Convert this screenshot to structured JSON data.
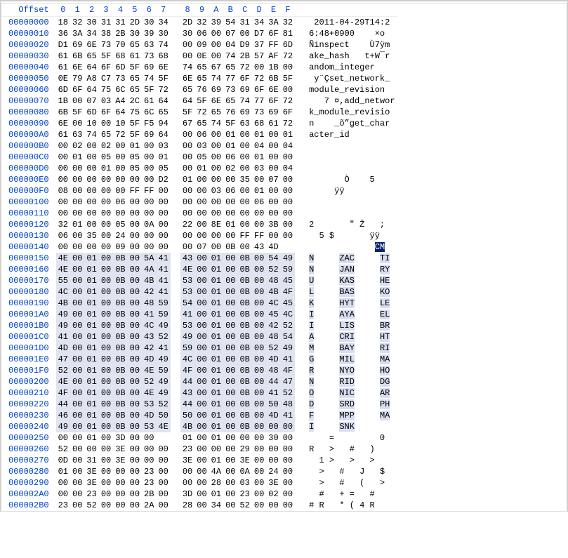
{
  "header": {
    "offset_label": "Offset",
    "cols": [
      "0",
      "1",
      "2",
      "3",
      "4",
      "5",
      "6",
      "7",
      "8",
      "9",
      "A",
      "B",
      "C",
      "D",
      "E",
      "F"
    ]
  },
  "rows": [
    {
      "ofs": "00000000",
      "hex": [
        "18",
        "32",
        "30",
        "31",
        "31",
        "2D",
        "30",
        "34",
        "2D",
        "32",
        "39",
        "54",
        "31",
        "34",
        "3A",
        "32"
      ],
      "asc": " 2011-04-29T14:2",
      "hl": false
    },
    {
      "ofs": "00000010",
      "hex": [
        "36",
        "3A",
        "34",
        "38",
        "2B",
        "30",
        "39",
        "30",
        "30",
        "06",
        "00",
        "07",
        "00",
        "D7",
        "6F",
        "81"
      ],
      "asc": "6:48+0900    ×o ",
      "hl": false
    },
    {
      "ofs": "00000020",
      "hex": [
        "D1",
        "69",
        "6E",
        "73",
        "70",
        "65",
        "63",
        "74",
        "00",
        "09",
        "00",
        "04",
        "D9",
        "37",
        "FF",
        "6D"
      ],
      "asc": "Ñinspect    Ù7ÿm",
      "hl": false
    },
    {
      "ofs": "00000030",
      "hex": [
        "61",
        "6B",
        "65",
        "5F",
        "68",
        "61",
        "73",
        "68",
        "00",
        "0E",
        "00",
        "74",
        "2B",
        "57",
        "AF",
        "72"
      ],
      "asc": "ake_hash   t+W¯r",
      "hl": false
    },
    {
      "ofs": "00000040",
      "hex": [
        "61",
        "6E",
        "64",
        "6F",
        "6D",
        "5F",
        "69",
        "6E",
        "74",
        "65",
        "67",
        "65",
        "72",
        "00",
        "1B",
        "00"
      ],
      "asc": "andom_integer   ",
      "hl": false
    },
    {
      "ofs": "00000050",
      "hex": [
        "0E",
        "79",
        "A8",
        "C7",
        "73",
        "65",
        "74",
        "5F",
        "6E",
        "65",
        "74",
        "77",
        "6F",
        "72",
        "6B",
        "5F"
      ],
      "asc": " y¨Çset_network_",
      "hl": false
    },
    {
      "ofs": "00000060",
      "hex": [
        "6D",
        "6F",
        "64",
        "75",
        "6C",
        "65",
        "5F",
        "72",
        "65",
        "76",
        "69",
        "73",
        "69",
        "6F",
        "6E",
        "00"
      ],
      "asc": "module_revision ",
      "hl": false
    },
    {
      "ofs": "00000070",
      "hex": [
        "1B",
        "00",
        "07",
        "03",
        "A4",
        "2C",
        "61",
        "64",
        "64",
        "5F",
        "6E",
        "65",
        "74",
        "77",
        "6F",
        "72"
      ],
      "asc": "   7 ¤,add_networ",
      "hl": false
    },
    {
      "ofs": "00000080",
      "hex": [
        "6B",
        "5F",
        "6D",
        "6F",
        "64",
        "75",
        "6C",
        "65",
        "5F",
        "72",
        "65",
        "76",
        "69",
        "73",
        "69",
        "6F"
      ],
      "asc": "k_module_revisio",
      "hl": false
    },
    {
      "ofs": "00000090",
      "hex": [
        "6E",
        "00",
        "10",
        "00",
        "10",
        "5F",
        "F5",
        "94",
        "67",
        "65",
        "74",
        "5F",
        "63",
        "68",
        "61",
        "72"
      ],
      "asc": "n    _õ”get_char",
      "hl": false
    },
    {
      "ofs": "000000A0",
      "hex": [
        "61",
        "63",
        "74",
        "65",
        "72",
        "5F",
        "69",
        "64",
        "00",
        "06",
        "00",
        "01",
        "00",
        "01",
        "00",
        "01"
      ],
      "asc": "acter_id        ",
      "hl": false
    },
    {
      "ofs": "000000B0",
      "hex": [
        "00",
        "02",
        "00",
        "02",
        "00",
        "01",
        "00",
        "03",
        "00",
        "03",
        "00",
        "01",
        "00",
        "04",
        "00",
        "04"
      ],
      "asc": "                ",
      "hl": false
    },
    {
      "ofs": "000000C0",
      "hex": [
        "00",
        "01",
        "00",
        "05",
        "00",
        "05",
        "00",
        "01",
        "00",
        "05",
        "00",
        "06",
        "00",
        "01",
        "00",
        "00"
      ],
      "asc": "                ",
      "hl": false
    },
    {
      "ofs": "000000D0",
      "hex": [
        "00",
        "00",
        "00",
        "01",
        "00",
        "05",
        "00",
        "05",
        "00",
        "01",
        "00",
        "02",
        "00",
        "03",
        "00",
        "04"
      ],
      "asc": "                ",
      "hl": false
    },
    {
      "ofs": "000000E0",
      "hex": [
        "00",
        "00",
        "00",
        "00",
        "00",
        "00",
        "00",
        "D2",
        "01",
        "00",
        "00",
        "00",
        "35",
        "00",
        "07",
        "00"
      ],
      "asc": "       Ò    5   ",
      "hl": false
    },
    {
      "ofs": "000000F0",
      "hex": [
        "08",
        "00",
        "00",
        "00",
        "00",
        "FF",
        "FF",
        "00",
        "00",
        "00",
        "03",
        "06",
        "00",
        "01",
        "00",
        "00"
      ],
      "asc": "     ÿÿ         ",
      "hl": false
    },
    {
      "ofs": "00000100",
      "hex": [
        "00",
        "00",
        "00",
        "00",
        "06",
        "00",
        "00",
        "00",
        "00",
        "00",
        "00",
        "00",
        "00",
        "06",
        "00",
        "00"
      ],
      "asc": "                ",
      "hl": false
    },
    {
      "ofs": "00000110",
      "hex": [
        "00",
        "00",
        "00",
        "00",
        "00",
        "00",
        "00",
        "00",
        "00",
        "00",
        "00",
        "00",
        "00",
        "00",
        "00",
        "00"
      ],
      "asc": "                ",
      "hl": false
    },
    {
      "ofs": "00000120",
      "hex": [
        "32",
        "01",
        "00",
        "00",
        "05",
        "00",
        "0A",
        "00",
        "22",
        "00",
        "8E",
        "01",
        "00",
        "00",
        "3B",
        "00"
      ],
      "asc": "2       \" Ž   ; ",
      "hl": false
    },
    {
      "ofs": "00000130",
      "hex": [
        "06",
        "00",
        "35",
        "00",
        "24",
        "00",
        "00",
        "00",
        "00",
        "00",
        "00",
        "00",
        "FF",
        "FF",
        "00",
        "00"
      ],
      "asc": "  5 $       ÿÿ  ",
      "hl": false
    },
    {
      "ofs": "00000140",
      "hex": [
        "00",
        "00",
        "00",
        "00",
        "09",
        "00",
        "00",
        "00",
        "00",
        "07",
        "00",
        "0B",
        "00",
        "43",
        "4D",
        "",
        ""
      ],
      "asc": "             CM",
      "hl": false,
      "cursor": 14
    },
    {
      "ofs": "00000150",
      "hex": [
        "4E",
        "00",
        "01",
        "00",
        "0B",
        "00",
        "5A",
        "41",
        "43",
        "00",
        "01",
        "00",
        "0B",
        "00",
        "54",
        "49"
      ],
      "asc": "N     ZAC     TI",
      "hl": true
    },
    {
      "ofs": "00000160",
      "hex": [
        "4E",
        "00",
        "01",
        "00",
        "0B",
        "00",
        "4A",
        "41",
        "4E",
        "00",
        "01",
        "00",
        "0B",
        "00",
        "52",
        "59"
      ],
      "asc": "N     JAN     RY",
      "hl": true
    },
    {
      "ofs": "00000170",
      "hex": [
        "55",
        "00",
        "01",
        "00",
        "0B",
        "00",
        "4B",
        "41",
        "53",
        "00",
        "01",
        "00",
        "0B",
        "00",
        "48",
        "45"
      ],
      "asc": "U     KAS     HE",
      "hl": true
    },
    {
      "ofs": "00000180",
      "hex": [
        "4C",
        "00",
        "01",
        "00",
        "0B",
        "00",
        "42",
        "41",
        "53",
        "00",
        "01",
        "00",
        "0B",
        "00",
        "4B",
        "4F"
      ],
      "asc": "L     BAS     KO",
      "hl": true
    },
    {
      "ofs": "00000190",
      "hex": [
        "4B",
        "00",
        "01",
        "00",
        "0B",
        "00",
        "48",
        "59",
        "54",
        "00",
        "01",
        "00",
        "0B",
        "00",
        "4C",
        "45"
      ],
      "asc": "K     HYT     LE",
      "hl": true
    },
    {
      "ofs": "000001A0",
      "hex": [
        "49",
        "00",
        "01",
        "00",
        "0B",
        "00",
        "41",
        "59",
        "41",
        "00",
        "01",
        "00",
        "0B",
        "00",
        "45",
        "4C"
      ],
      "asc": "I     AYA     EL",
      "hl": true
    },
    {
      "ofs": "000001B0",
      "hex": [
        "49",
        "00",
        "01",
        "00",
        "0B",
        "00",
        "4C",
        "49",
        "53",
        "00",
        "01",
        "00",
        "0B",
        "00",
        "42",
        "52"
      ],
      "asc": "I     LIS     BR",
      "hl": true
    },
    {
      "ofs": "000001C0",
      "hex": [
        "41",
        "00",
        "01",
        "00",
        "0B",
        "00",
        "43",
        "52",
        "49",
        "00",
        "01",
        "00",
        "0B",
        "00",
        "48",
        "54"
      ],
      "asc": "A     CRI     HT",
      "hl": true
    },
    {
      "ofs": "000001D0",
      "hex": [
        "4D",
        "00",
        "01",
        "00",
        "0B",
        "00",
        "42",
        "41",
        "59",
        "00",
        "01",
        "00",
        "0B",
        "00",
        "52",
        "49"
      ],
      "asc": "M     BAY     RI",
      "hl": true
    },
    {
      "ofs": "000001E0",
      "hex": [
        "47",
        "00",
        "01",
        "00",
        "0B",
        "00",
        "4D",
        "49",
        "4C",
        "00",
        "01",
        "00",
        "0B",
        "00",
        "4D",
        "41"
      ],
      "asc": "G     MIL     MA",
      "hl": true
    },
    {
      "ofs": "000001F0",
      "hex": [
        "52",
        "00",
        "01",
        "00",
        "0B",
        "00",
        "4E",
        "59",
        "4F",
        "00",
        "01",
        "00",
        "0B",
        "00",
        "48",
        "4F"
      ],
      "asc": "R     NYO     HO",
      "hl": true
    },
    {
      "ofs": "00000200",
      "hex": [
        "4E",
        "00",
        "01",
        "00",
        "0B",
        "00",
        "52",
        "49",
        "44",
        "00",
        "01",
        "00",
        "0B",
        "00",
        "44",
        "47"
      ],
      "asc": "N     RID     DG",
      "hl": true
    },
    {
      "ofs": "00000210",
      "hex": [
        "4F",
        "00",
        "01",
        "00",
        "0B",
        "00",
        "4E",
        "49",
        "43",
        "00",
        "01",
        "00",
        "0B",
        "00",
        "41",
        "52"
      ],
      "asc": "O     NIC     AR",
      "hl": true
    },
    {
      "ofs": "00000220",
      "hex": [
        "44",
        "00",
        "01",
        "00",
        "0B",
        "00",
        "53",
        "52",
        "44",
        "00",
        "01",
        "00",
        "0B",
        "00",
        "50",
        "48"
      ],
      "asc": "D     SRD     PH",
      "hl": true
    },
    {
      "ofs": "00000230",
      "hex": [
        "46",
        "00",
        "01",
        "00",
        "0B",
        "00",
        "4D",
        "50",
        "50",
        "00",
        "01",
        "00",
        "0B",
        "00",
        "4D",
        "41"
      ],
      "asc": "F     MPP     MA",
      "hl": true
    },
    {
      "ofs": "00000240",
      "hex": [
        "49",
        "00",
        "01",
        "00",
        "0B",
        "00",
        "53",
        "4E",
        "4B",
        "00",
        "01",
        "00",
        "0B",
        "00",
        "00",
        "00"
      ],
      "asc": "I     SNK       ",
      "hl": true
    },
    {
      "ofs": "00000250",
      "hex": [
        "00",
        "00",
        "01",
        "00",
        "3D",
        "00",
        "00",
        "",
        "01",
        "00",
        "01",
        "00",
        "00",
        "00",
        "30",
        "00"
      ],
      "asc": "    =         0 ",
      "hl": false
    },
    {
      "ofs": "00000260",
      "hex": [
        "52",
        "00",
        "00",
        "00",
        "3E",
        "00",
        "00",
        "00",
        "23",
        "00",
        "00",
        "00",
        "29",
        "00",
        "00",
        "00"
      ],
      "asc": "R   >   #   )   ",
      "hl": false
    },
    {
      "ofs": "00000270",
      "hex": [
        "0D",
        "00",
        "31",
        "00",
        "3E",
        "00",
        "00",
        "00",
        "3E",
        "00",
        "01",
        "00",
        "3E",
        "00",
        "00",
        "00"
      ],
      "asc": "  1 >   >   >   ",
      "hl": false
    },
    {
      "ofs": "00000280",
      "hex": [
        "01",
        "00",
        "3E",
        "00",
        "00",
        "00",
        "23",
        "00",
        "00",
        "00",
        "4A",
        "00",
        "0A",
        "00",
        "24",
        "00"
      ],
      "asc": "  >   #   J   $ ",
      "hl": false
    },
    {
      "ofs": "00000290",
      "hex": [
        "00",
        "00",
        "3E",
        "00",
        "00",
        "00",
        "23",
        "00",
        "00",
        "00",
        "28",
        "00",
        "03",
        "00",
        "3E",
        "00"
      ],
      "asc": "  >   #   (   > ",
      "hl": false
    },
    {
      "ofs": "000002A0",
      "hex": [
        "00",
        "00",
        "23",
        "00",
        "00",
        "00",
        "2B",
        "00",
        "3D",
        "00",
        "01",
        "00",
        "23",
        "00",
        "02",
        "00"
      ],
      "asc": "  #   + =   #   ",
      "hl": false
    },
    {
      "ofs": "000002B0",
      "hex": [
        "23",
        "00",
        "52",
        "00",
        "00",
        "00",
        "2A",
        "00",
        "28",
        "00",
        "34",
        "00",
        "52",
        "00",
        "00",
        "00"
      ],
      "asc": "# R   * ( 4 R   ",
      "hl": false
    }
  ]
}
